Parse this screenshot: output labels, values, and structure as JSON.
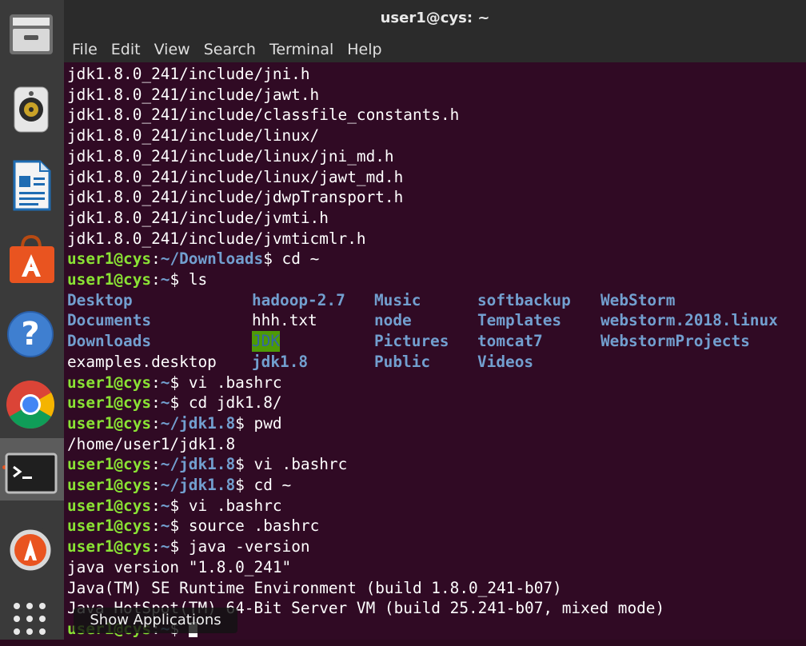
{
  "window": {
    "title": "user1@cys: ~"
  },
  "menu": [
    "File",
    "Edit",
    "View",
    "Search",
    "Terminal",
    "Help"
  ],
  "dock": {
    "items": [
      {
        "icon": "files-icon"
      },
      {
        "icon": "rhythmbox-icon"
      },
      {
        "icon": "libreoffice-writer-icon"
      },
      {
        "icon": "software-center-icon"
      },
      {
        "icon": "help-icon"
      },
      {
        "icon": "chrome-icon"
      },
      {
        "icon": "terminal-icon",
        "active": true
      },
      {
        "icon": "software-updater-icon"
      }
    ],
    "show_apps_icon": "grid-icon",
    "tooltip": "Show Applications"
  },
  "terminal": {
    "prompt_user": "user1@cys",
    "output_before": [
      "jdk1.8.0_241/include/jni.h",
      "jdk1.8.0_241/include/jawt.h",
      "jdk1.8.0_241/include/classfile_constants.h",
      "jdk1.8.0_241/include/linux/",
      "jdk1.8.0_241/include/linux/jni_md.h",
      "jdk1.8.0_241/include/linux/jawt_md.h",
      "jdk1.8.0_241/include/jdwpTransport.h",
      "jdk1.8.0_241/include/jvmti.h",
      "jdk1.8.0_241/include/jvmticmlr.h"
    ],
    "commands_before_ls": [
      {
        "path": "~/Downloads",
        "cmd": "cd ~"
      },
      {
        "path": "~",
        "cmd": "ls"
      }
    ],
    "ls_columns": [
      [
        {
          "name": "Desktop",
          "type": "dir"
        },
        {
          "name": "Documents",
          "type": "dir"
        },
        {
          "name": "Downloads",
          "type": "dir"
        },
        {
          "name": "examples.desktop",
          "type": "file"
        }
      ],
      [
        {
          "name": "hadoop-2.7",
          "type": "dir"
        },
        {
          "name": "hhh.txt",
          "type": "file"
        },
        {
          "name": "JDK",
          "type": "highlight"
        },
        {
          "name": "jdk1.8",
          "type": "dir"
        }
      ],
      [
        {
          "name": "Music",
          "type": "dir"
        },
        {
          "name": "node",
          "type": "dir"
        },
        {
          "name": "Pictures",
          "type": "dir"
        },
        {
          "name": "Public",
          "type": "dir"
        }
      ],
      [
        {
          "name": "softbackup",
          "type": "dir"
        },
        {
          "name": "Templates",
          "type": "dir"
        },
        {
          "name": "tomcat7",
          "type": "dir"
        },
        {
          "name": "Videos",
          "type": "dir"
        }
      ],
      [
        {
          "name": "WebStorm",
          "type": "dir"
        },
        {
          "name": "webstorm.2018.linux",
          "type": "dir"
        },
        {
          "name": "WebstormProjects",
          "type": "dir"
        }
      ]
    ],
    "session_after_ls": [
      {
        "kind": "prompt",
        "path": "~",
        "cmd": "vi .bashrc"
      },
      {
        "kind": "prompt",
        "path": "~",
        "cmd": "cd jdk1.8/"
      },
      {
        "kind": "prompt",
        "path": "~/jdk1.8",
        "cmd": "pwd"
      },
      {
        "kind": "output",
        "text": "/home/user1/jdk1.8"
      },
      {
        "kind": "prompt",
        "path": "~/jdk1.8",
        "cmd": "vi .bashrc"
      },
      {
        "kind": "prompt",
        "path": "~/jdk1.8",
        "cmd": "cd ~"
      },
      {
        "kind": "prompt",
        "path": "~",
        "cmd": "vi .bashrc"
      },
      {
        "kind": "prompt",
        "path": "~",
        "cmd": "source .bashrc"
      },
      {
        "kind": "prompt",
        "path": "~",
        "cmd": "java -version"
      },
      {
        "kind": "output",
        "text": "java version \"1.8.0_241\""
      },
      {
        "kind": "output",
        "text": "Java(TM) SE Runtime Environment (build 1.8.0_241-b07)"
      },
      {
        "kind": "output",
        "text": "Java HotSpot(TM) 64-Bit Server VM (build 25.241-b07, mixed mode)"
      },
      {
        "kind": "prompt",
        "path": "~",
        "cmd": "",
        "cursor": true
      }
    ]
  }
}
